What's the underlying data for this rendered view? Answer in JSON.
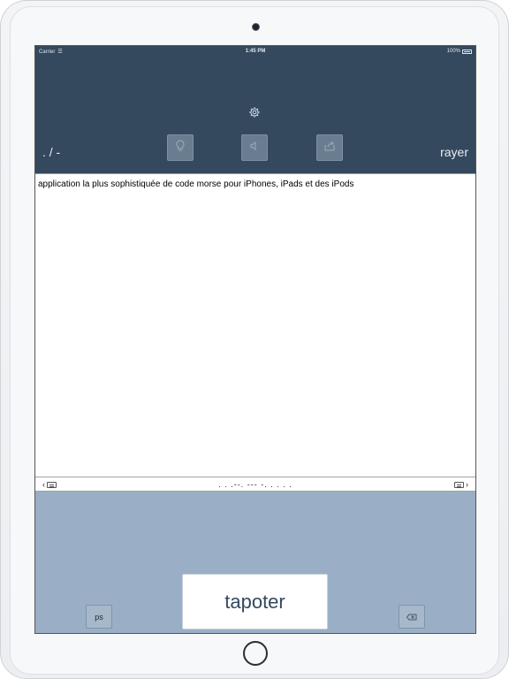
{
  "status_bar": {
    "carrier": "Carrier",
    "time": "1:45 PM",
    "battery_percent": "100%"
  },
  "header": {
    "mode_label": ". / -",
    "clear_label": "rayer",
    "icons": [
      "gear-icon",
      "lightbulb-icon",
      "speaker-icon",
      "share-icon"
    ]
  },
  "editor": {
    "text": "application la plus sophistiquée de code morse pour iPhones, iPads et des iPods"
  },
  "morse_bar": {
    "morse": ". . .--. --- -. . . . .",
    "left_icon": "keyboard-left-icon",
    "right_icon": "keyboard-right-icon"
  },
  "keyboard": {
    "ps_label": "ps",
    "tap_label": "tapoter",
    "delete_icon": "delete-icon"
  },
  "colors": {
    "header_bg": "#34495e",
    "keyboard_bg": "#9aafc5",
    "tap_text": "#34495e"
  }
}
